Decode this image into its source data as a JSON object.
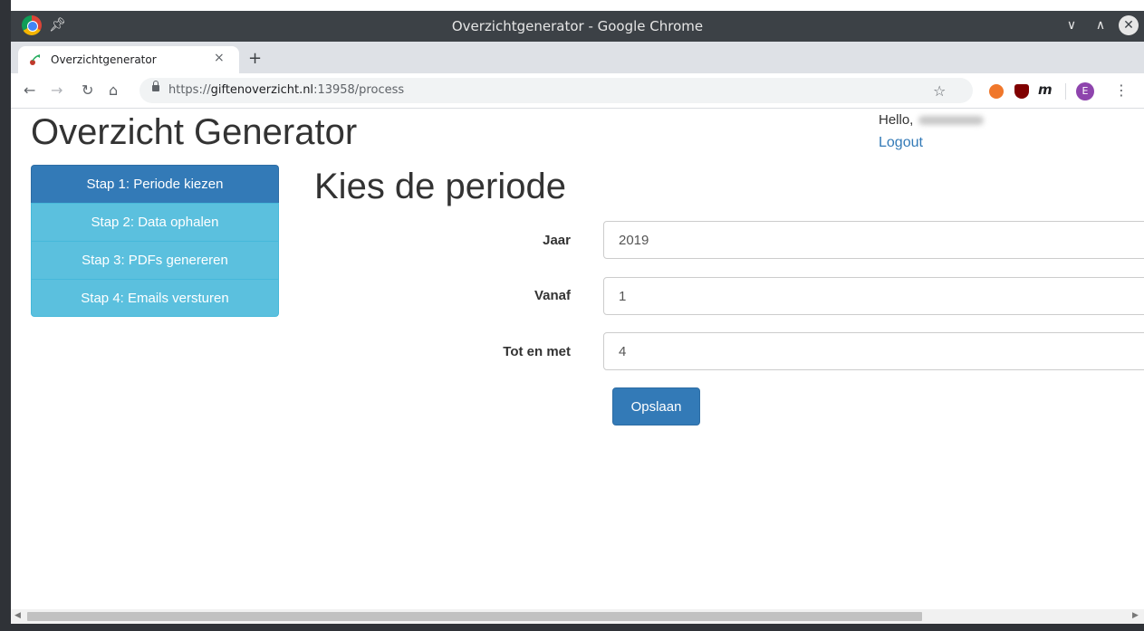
{
  "window": {
    "title": "Overzichtgenerator - Google Chrome",
    "controls": [
      "minimize",
      "maximize",
      "close"
    ]
  },
  "tab": {
    "title": "Overzichtgenerator",
    "close_glyph": "×",
    "new_tab_glyph": "+"
  },
  "toolbar": {
    "url_scheme": "https://",
    "url_host": "giftenoverzicht.nl",
    "url_rest": ":13958/process",
    "profile_initial": "E",
    "extension_m": "m"
  },
  "header": {
    "app_title": "Overzicht Generator",
    "hello": "Hello,",
    "logout": "Logout"
  },
  "steps": [
    {
      "label": "Stap 1: Periode kiezen",
      "active": true
    },
    {
      "label": "Stap 2: Data ophalen",
      "active": false
    },
    {
      "label": "Stap 3: PDFs genereren",
      "active": false
    },
    {
      "label": "Stap 4: Emails versturen",
      "active": false
    }
  ],
  "form": {
    "title": "Kies de periode",
    "year_label": "Jaar",
    "year_value": "2019",
    "from_label": "Vanaf",
    "from_value": "1",
    "to_label": "Tot en met",
    "to_value": "4",
    "save_label": "Opslaan"
  },
  "colors": {
    "primary": "#337ab7",
    "info": "#5bc0de",
    "link": "#337ab7",
    "titlebar": "#3c4146"
  },
  "icons": [
    "chrome-logo-icon",
    "pin-icon",
    "back-icon",
    "forward-icon",
    "reload-icon",
    "home-icon",
    "lock-icon",
    "star-icon",
    "menu-icon"
  ]
}
